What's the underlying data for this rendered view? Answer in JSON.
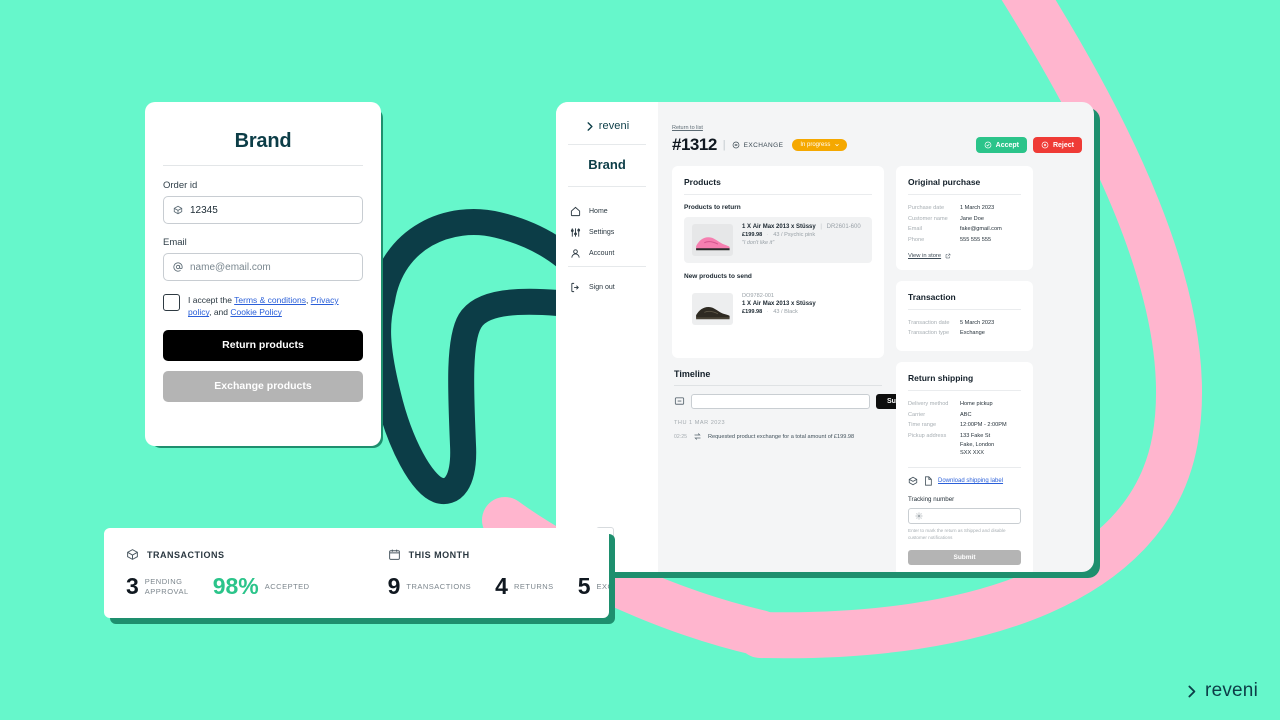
{
  "background": {
    "mint": "#66F7CB",
    "pink": "#FFB5CE",
    "dark_teal": "#0C3D47",
    "shadow_green": "#1E8F6E"
  },
  "watermark": {
    "text": "reveni",
    "icon": "reveni-logo-icon"
  },
  "return_form": {
    "title": "Brand",
    "order_id": {
      "label": "Order id",
      "value": "12345",
      "icon": "package-icon"
    },
    "email": {
      "label": "Email",
      "placeholder": "name@email.com",
      "value": "",
      "icon": "at-icon"
    },
    "consent": {
      "prefix": "I accept the ",
      "link_terms": "Terms & conditions",
      "sep1": ", ",
      "link_privacy": "Privacy policy",
      "sep2": ", and ",
      "link_cookie": "Cookie Policy",
      "checked": false
    },
    "return_button": "Return products",
    "exchange_button": "Exchange products"
  },
  "dashboard": {
    "sidebar": {
      "logo_text": "reveni",
      "brand": "Brand",
      "nav": [
        {
          "label": "Home",
          "icon": "home-icon"
        },
        {
          "label": "Settings",
          "icon": "sliders-icon"
        },
        {
          "label": "Account",
          "icon": "user-icon"
        }
      ],
      "sign_out": {
        "label": "Sign out",
        "icon": "sign-out-icon"
      }
    },
    "header": {
      "return_link": "Return to list",
      "order_number": "#1312",
      "divider": "|",
      "type_label": "EXCHANGE",
      "type_icon": "exchange-icon",
      "status": "In progress",
      "status_color": "#F5A800",
      "accept_button": "Accept",
      "reject_button": "Reject",
      "accept_color": "#2BC48A",
      "reject_color": "#EF3B36"
    },
    "products_card": {
      "title": "Products",
      "to_return_heading": "Products to return",
      "to_return": [
        {
          "qty": "1 X",
          "name": "Air Max 2013 x Stüssy",
          "sku": "DR2601-600",
          "price": "£199.98",
          "variant": "43 / Psychic pink",
          "note": "\"I don't like it\"",
          "thumb": "pink-sneaker-image"
        }
      ],
      "to_send_heading": "New products to send",
      "to_send": [
        {
          "code": "DO9782-001",
          "qty": "1 X",
          "name": "Air Max 2013 x Stüssy",
          "price": "£199.98",
          "variant": "43 / Black",
          "thumb": "black-sneaker-image"
        }
      ]
    },
    "timeline": {
      "title": "Timeline",
      "input_placeholder": "",
      "input_value": "",
      "input_icon": "comment-icon",
      "submit_label": "Submit",
      "date_group": "THU 1 MAR 2023",
      "entries": [
        {
          "time": "02:25",
          "icon": "exchange-arrows-icon",
          "text": "Requested product exchange for a total amount of £199.98"
        }
      ]
    },
    "original_purchase": {
      "title": "Original purchase",
      "rows": [
        {
          "key": "Purchase date",
          "value": "1 March 2023"
        },
        {
          "key": "Customer name",
          "value": "Jane Doe"
        },
        {
          "key": "Email",
          "value": "fake@gmail.com"
        },
        {
          "key": "Phone",
          "value": "555 555 555"
        }
      ],
      "link": "View in store",
      "link_icon": "external-link-icon"
    },
    "transaction": {
      "title": "Transaction",
      "rows": [
        {
          "key": "Transaction date",
          "value": "5 March 2023"
        },
        {
          "key": "Transaction type",
          "value": "Exchange"
        }
      ]
    },
    "return_shipping": {
      "title": "Return shipping",
      "rows": [
        {
          "key": "Delivery method",
          "value": "Home pickup"
        },
        {
          "key": "Carrier",
          "value": "ABC"
        },
        {
          "key": "Time range",
          "value": "12:00PM - 2:00PM"
        },
        {
          "key": "Pickup address",
          "value": "133 Fake St\nFake, London\nSXX XXX"
        }
      ],
      "download_label": "Download shipping label",
      "download_icons": [
        "box-icon",
        "document-icon"
      ],
      "tracking_label": "Tracking number",
      "tracking_value": "",
      "tracking_icon": "gear-icon",
      "hint": "Enter to mark the return as Shipped and disable customer notifications",
      "submit_label": "Submit"
    }
  },
  "stats": {
    "groups": [
      {
        "heading": "TRANSACTIONS",
        "icon": "package-icon",
        "metrics": [
          {
            "number": "3",
            "label": "PENDING\nAPPROVAL",
            "color": "#101820"
          },
          {
            "number": "98%",
            "label": "ACCEPTED",
            "color": "#2BC48A"
          }
        ]
      },
      {
        "heading": "THIS MONTH",
        "icon": "calendar-icon",
        "metrics": [
          {
            "number": "9",
            "label": "TRANSACTIONS",
            "color": "#101820"
          },
          {
            "number": "4",
            "label": "RETURNS",
            "color": "#101820"
          },
          {
            "number": "5",
            "label": "EXCHANGES",
            "color": "#101820"
          }
        ]
      }
    ]
  }
}
